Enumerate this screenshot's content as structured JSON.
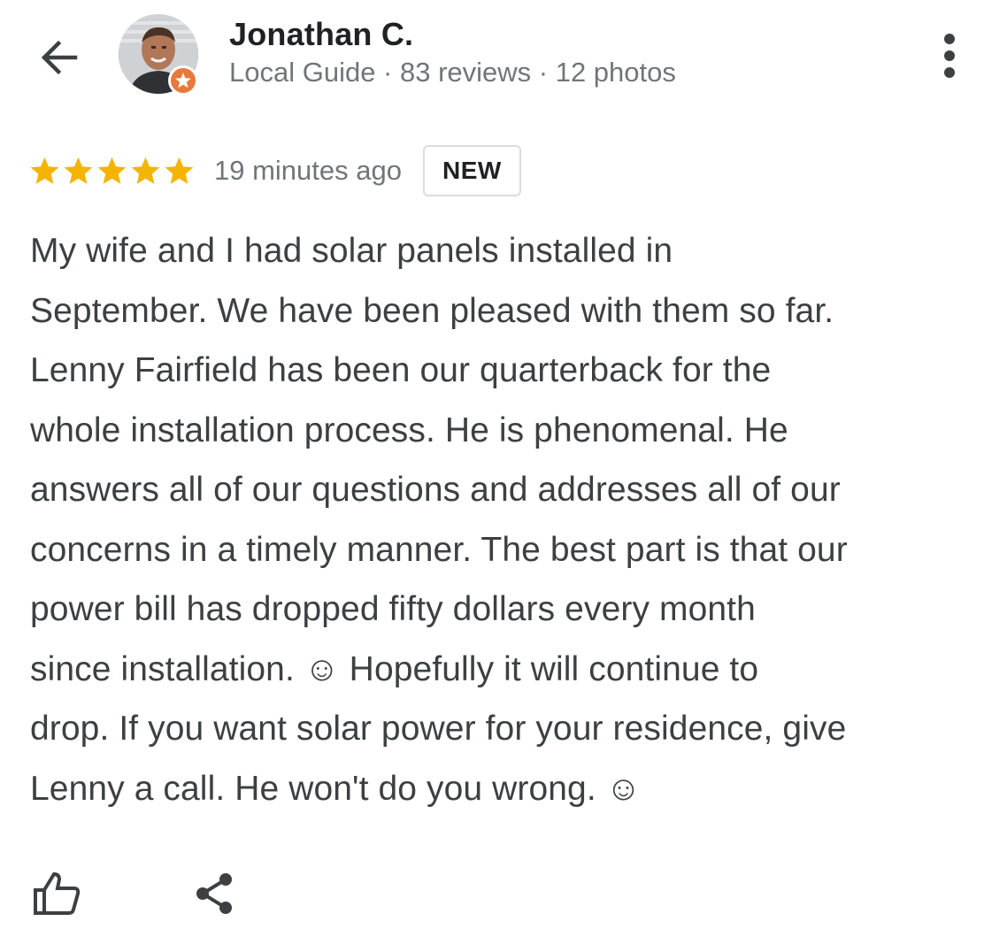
{
  "header": {
    "back_icon": "arrow-left-icon",
    "user_name": "Jonathan C.",
    "user_meta": "Local Guide · 83 reviews · 12 photos",
    "avatar_badge_icon": "local-guide-star-icon",
    "more_icon": "more-vertical-icon"
  },
  "review": {
    "rating": 5,
    "rating_max": 5,
    "star_color": "#f4b400",
    "time": "19 minutes ago",
    "badge": "NEW",
    "text": "My wife and I had solar panels installed in\nSeptember. We have been pleased with them so far.\nLenny Fairfield has been our quarterback for the\nwhole installation process. He is phenomenal. He\nanswers all of our questions and addresses all of our\nconcerns in a timely manner. The best part is that our\npower bill has dropped fifty dollars every month\nsince installation. ☺ Hopefully it will continue to\ndrop. If you want solar power for your residence, give\nLenny a call. He won't do you wrong. ☺"
  },
  "actions": {
    "like_icon": "thumb-up-icon",
    "share_icon": "share-icon"
  },
  "colors": {
    "badge_orange": "#e8783c",
    "text_primary": "#202124",
    "text_secondary": "#70757a"
  }
}
